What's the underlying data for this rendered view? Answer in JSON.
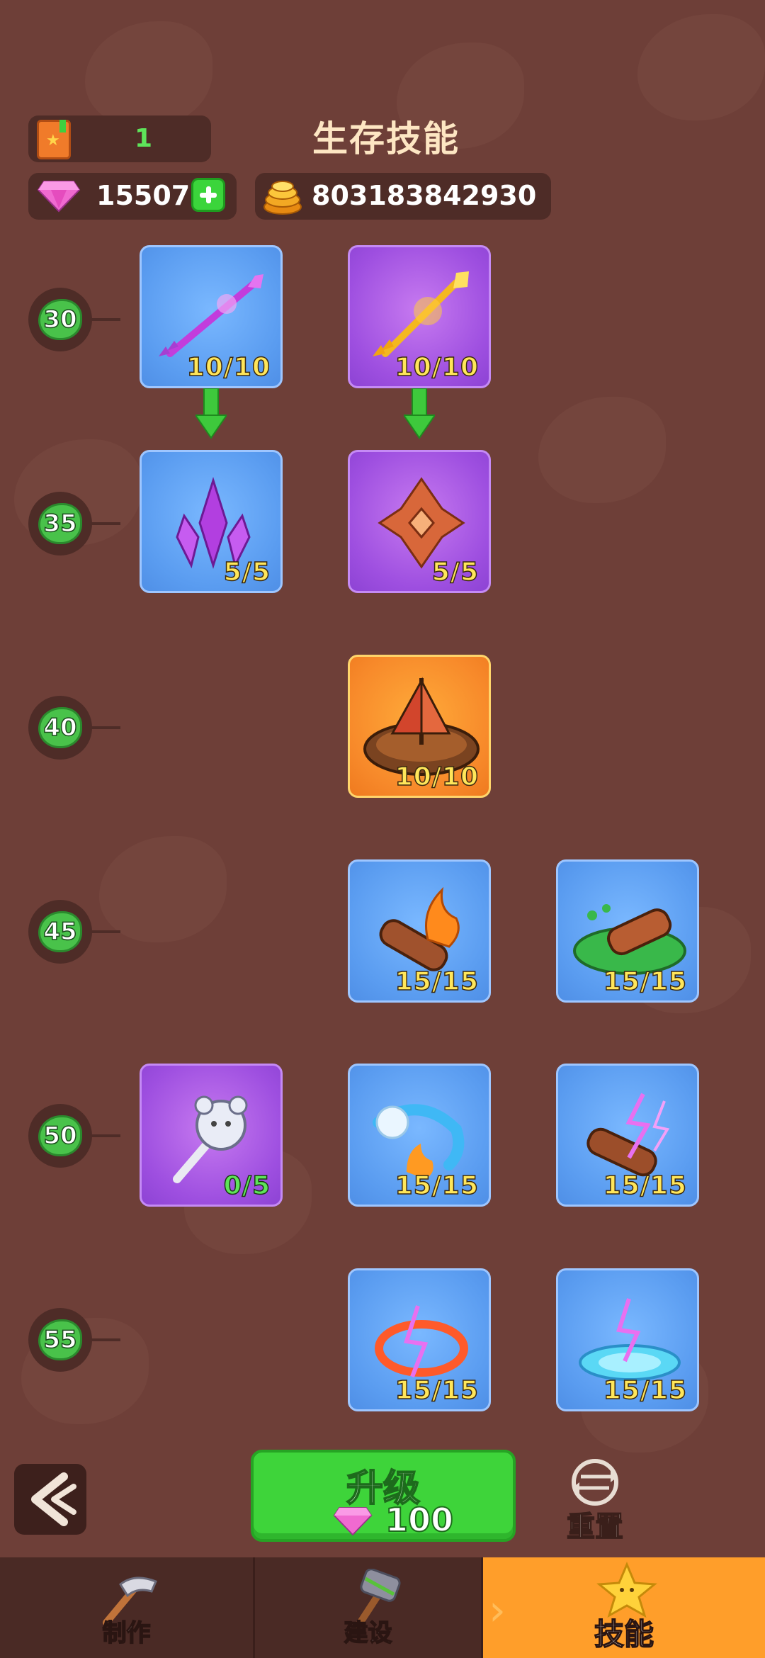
{
  "header": {
    "book_count": "1",
    "title": "生存技能",
    "gems": "15507",
    "coins": "803183842930"
  },
  "levels": [
    "30",
    "35",
    "40",
    "45",
    "50",
    "55"
  ],
  "cards": {
    "r30_a": "10/10",
    "r30_b": "10/10",
    "r35_a": "5/5",
    "r35_b": "5/5",
    "r40_b": "10/10",
    "r45_b": "15/15",
    "r45_c": "15/15",
    "r50_a": "0/5",
    "r50_b": "15/15",
    "r50_c": "15/15",
    "r55_b": "15/15",
    "r55_c": "15/15"
  },
  "actions": {
    "upgrade_label": "升级",
    "upgrade_cost": "100",
    "reset_label": "重置"
  },
  "nav": {
    "craft": "制作",
    "build": "建设",
    "skill": "技能"
  },
  "colors": {
    "background": "#6e3f38",
    "card_blue": "#5a9cf0",
    "card_purple": "#9e4fe0",
    "card_orange": "#f7892a",
    "count_text": "#ffe65a",
    "accent_green": "#3ed43a",
    "active_tab": "#ff9e2a"
  }
}
